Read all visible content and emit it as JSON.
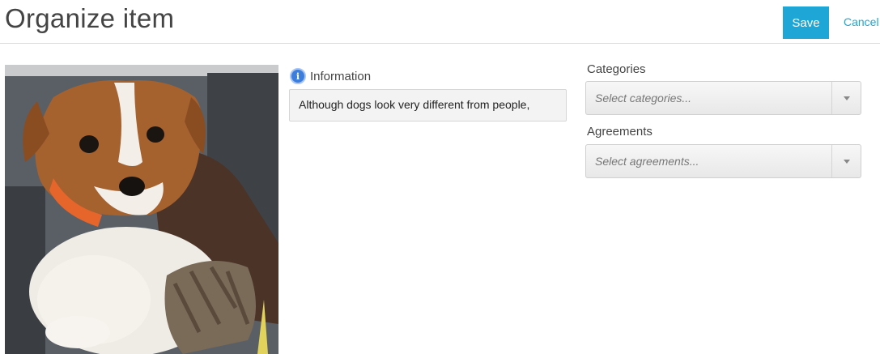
{
  "header": {
    "title": "Organize item",
    "save_label": "Save",
    "cancel_label": "Cancel",
    "accent_color": "#1ea6d6"
  },
  "item": {
    "image_alt": "Photo of a puppy",
    "information_label": "Information",
    "information_icon": "info-circle-icon",
    "information_value": "Although dogs look very different from people,"
  },
  "categories": {
    "label": "Categories",
    "placeholder": "Select categories..."
  },
  "agreements": {
    "label": "Agreements",
    "placeholder": "Select agreements..."
  }
}
